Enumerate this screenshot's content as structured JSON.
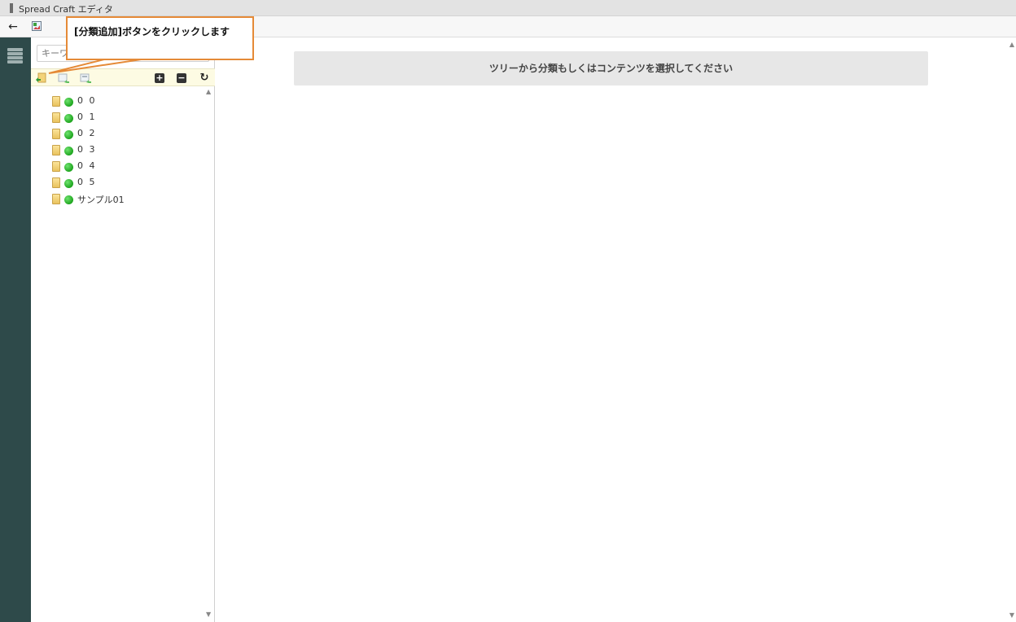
{
  "window": {
    "title": "Spread Craft エディタ"
  },
  "toolbar": {
    "back_icon": "arrow-left-icon",
    "image_icon": "image-icon"
  },
  "sidebar": {
    "menu_icon": "hamburger-menu-icon"
  },
  "tree_panel": {
    "search_placeholder": "キーワ",
    "tools": [
      "add-category-icon",
      "add-item-icon",
      "add-subitem-icon",
      "expand-all-icon",
      "collapse-all-icon",
      "refresh-icon"
    ],
    "nodes": [
      {
        "label": "0 0"
      },
      {
        "label": "0 1"
      },
      {
        "label": "0 2"
      },
      {
        "label": "0 3"
      },
      {
        "label": "0 4"
      },
      {
        "label": "0 5"
      },
      {
        "label": "サンプル01"
      }
    ]
  },
  "main": {
    "notice": "ツリーから分類もしくはコンテンツを選択してください"
  },
  "callout": {
    "text": "[分類追加]ボタンをクリックします",
    "border_color": "#e58a37"
  },
  "colors": {
    "sidebar": "#2e4a4a",
    "status_dot": "#1ea51e",
    "toolbar_bg": "#fdfbe3"
  }
}
